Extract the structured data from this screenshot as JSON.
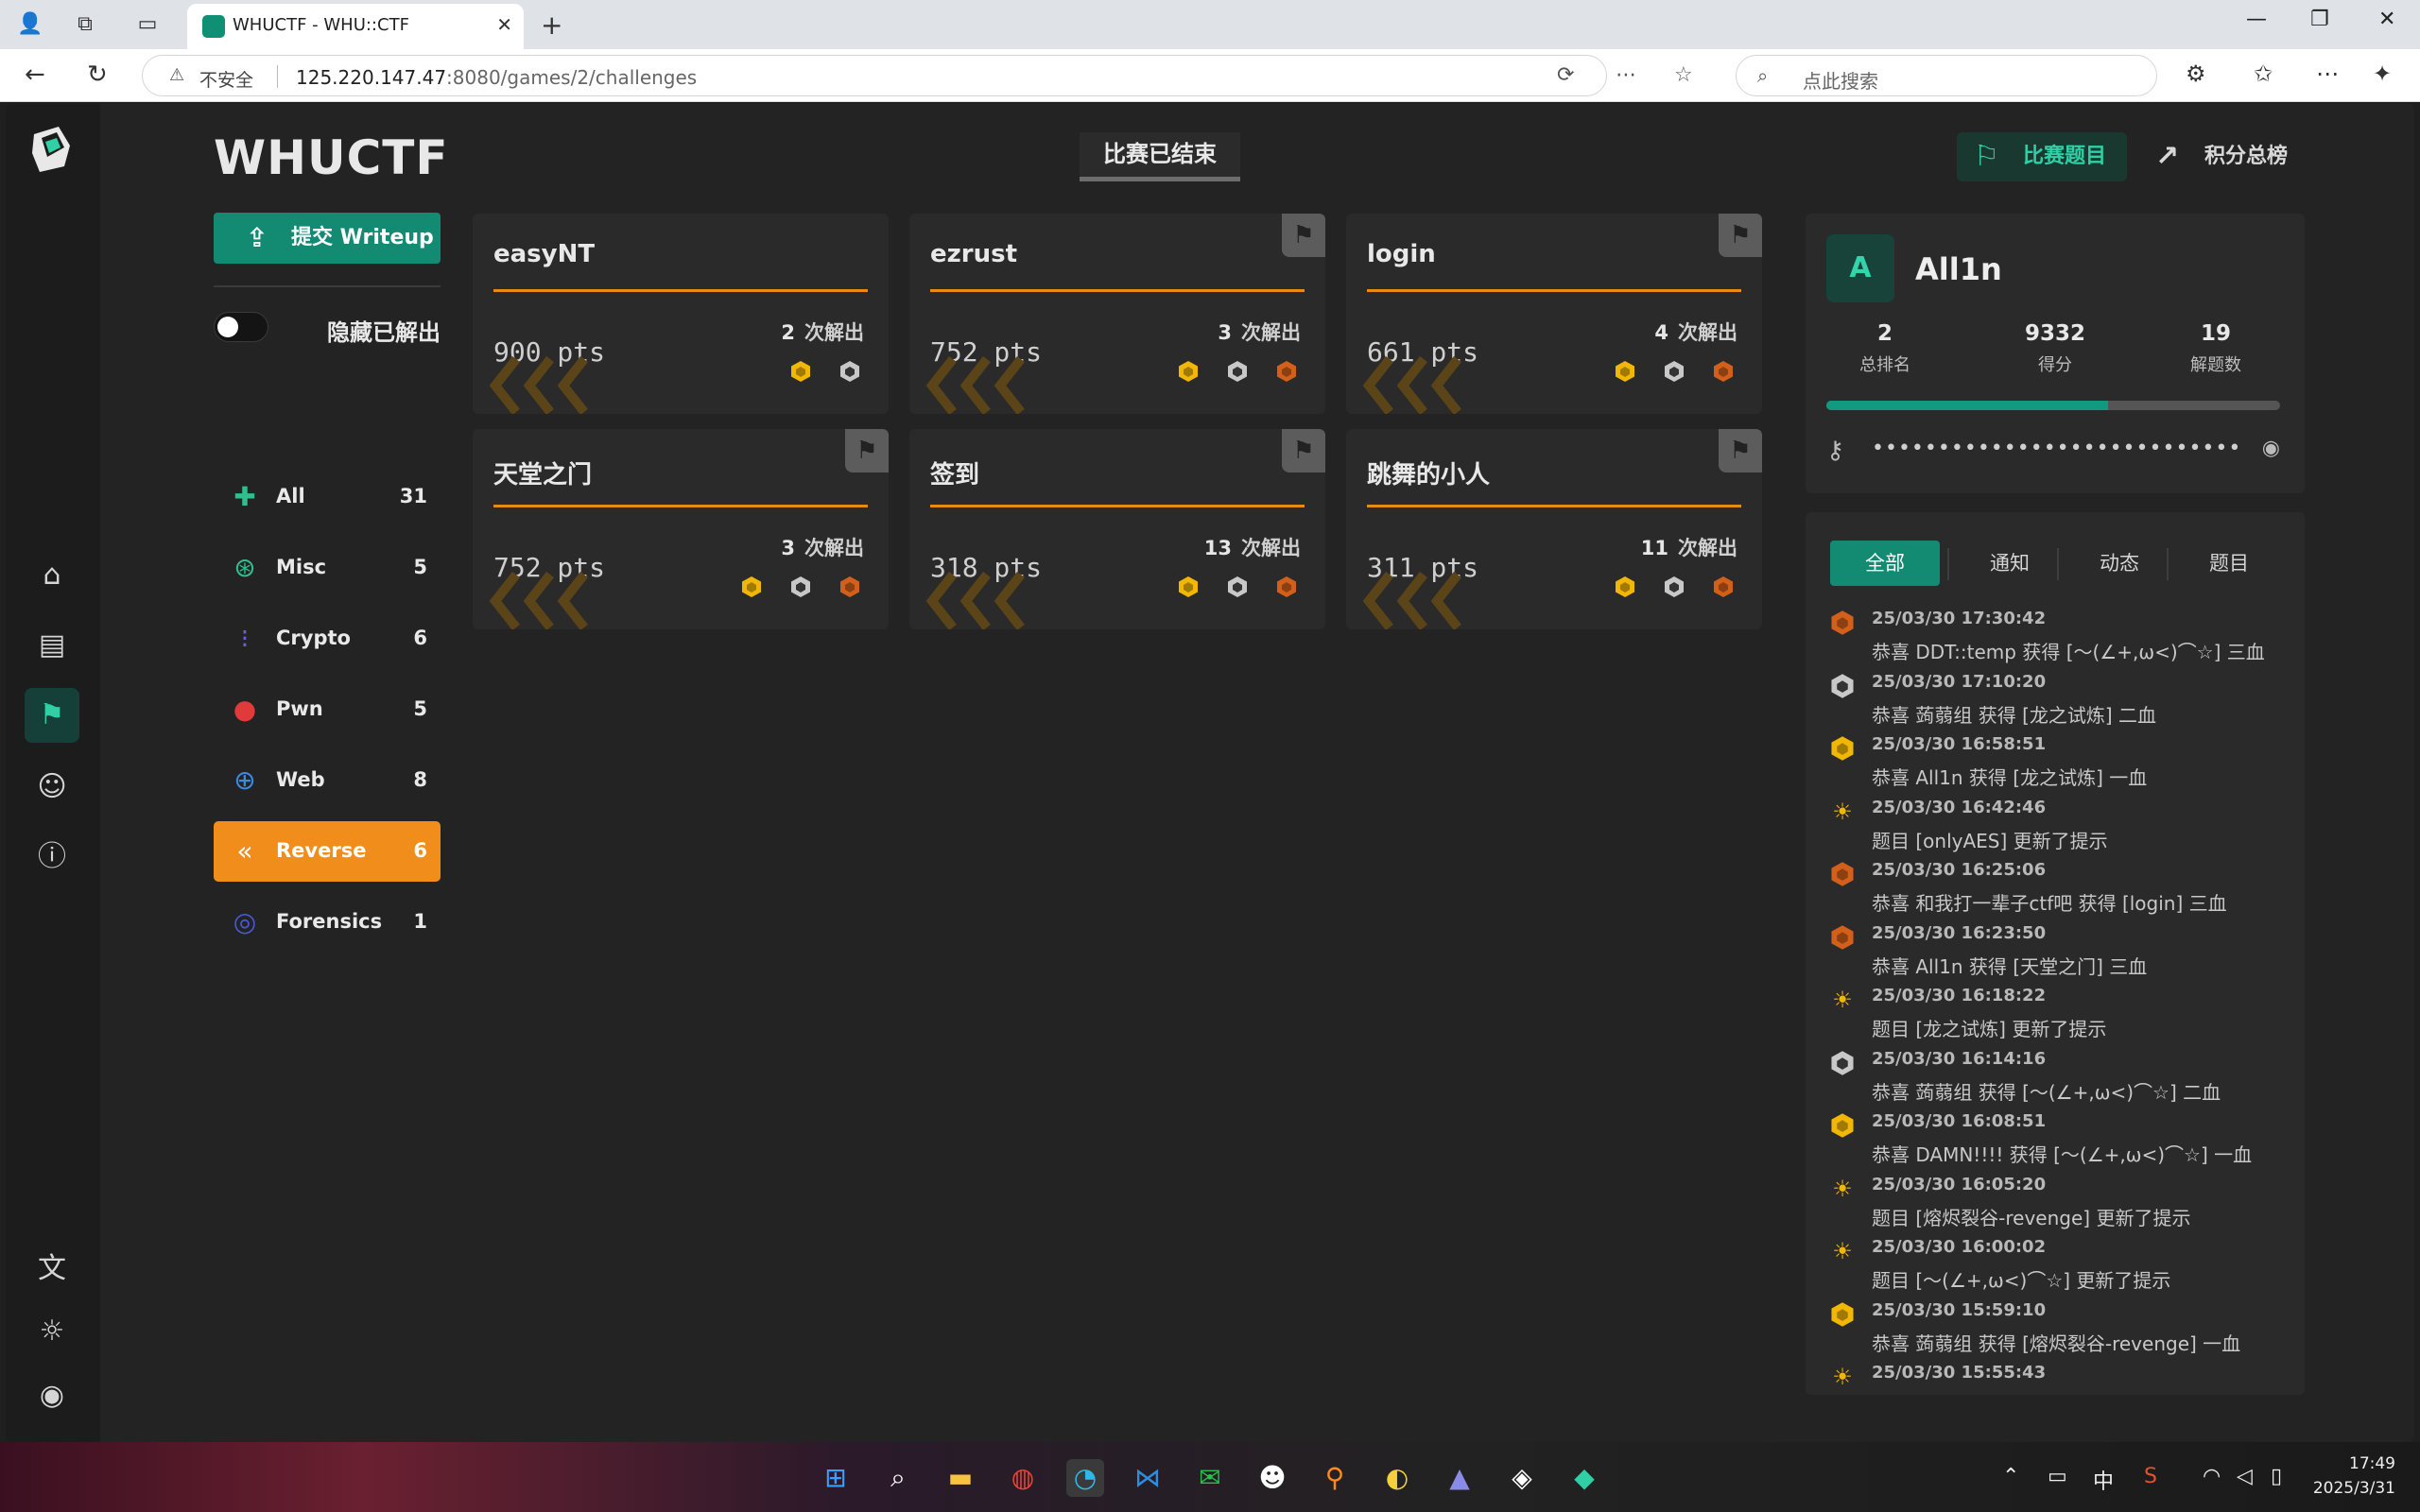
{
  "browser": {
    "tab_title": "WHUCTF - WHU::CTF",
    "insecure_label": "不安全",
    "url_host": "125.220.147.47",
    "url_rest": ":8080/games/2/challenges",
    "search_placeholder": "点此搜索"
  },
  "header": {
    "brand": "WHUCTF",
    "status": "比赛已结束",
    "nav_challenges": "比赛题目",
    "nav_scoreboard": "积分总榜"
  },
  "sidebar": {
    "submit_label": "提交 Writeup",
    "hide_solved_label": "隐藏已解出",
    "categories": [
      {
        "name": "All",
        "count": "31",
        "icon": "puzzle-icon",
        "color": "#2fbf8f"
      },
      {
        "name": "Misc",
        "count": "5",
        "icon": "gamepad-icon",
        "color": "#2fbf8f"
      },
      {
        "name": "Crypto",
        "count": "6",
        "icon": "binary-icon",
        "color": "#6b5bd6"
      },
      {
        "name": "Pwn",
        "count": "5",
        "icon": "bomb-icon",
        "color": "#e03a3a"
      },
      {
        "name": "Web",
        "count": "8",
        "icon": "globe-icon",
        "color": "#3a8ae0"
      },
      {
        "name": "Reverse",
        "count": "6",
        "icon": "chevrons-left-icon",
        "color": "#ffffff"
      },
      {
        "name": "Forensics",
        "count": "1",
        "icon": "fingerprint-icon",
        "color": "#4a5ad6"
      }
    ],
    "active_category": "Reverse"
  },
  "challenges": [
    {
      "title": "easyNT",
      "points": "900 pts",
      "solved_count": "2",
      "solved_label": "次解出",
      "bloods": [
        "gold",
        "silver"
      ],
      "has_flag": false
    },
    {
      "title": "ezrust",
      "points": "752 pts",
      "solved_count": "3",
      "solved_label": "次解出",
      "bloods": [
        "gold",
        "silver",
        "bronze"
      ],
      "has_flag": true
    },
    {
      "title": "login",
      "points": "661 pts",
      "solved_count": "4",
      "solved_label": "次解出",
      "bloods": [
        "gold",
        "silver",
        "bronze"
      ],
      "has_flag": true
    },
    {
      "title": "天堂之门",
      "points": "752 pts",
      "solved_count": "3",
      "solved_label": "次解出",
      "bloods": [
        "gold",
        "silver",
        "bronze"
      ],
      "has_flag": true
    },
    {
      "title": "签到",
      "points": "318 pts",
      "solved_count": "13",
      "solved_label": "次解出",
      "bloods": [
        "gold",
        "silver",
        "bronze"
      ],
      "has_flag": true
    },
    {
      "title": "跳舞的小人",
      "points": "311 pts",
      "solved_count": "11",
      "solved_label": "次解出",
      "bloods": [
        "gold",
        "silver",
        "bronze"
      ],
      "has_flag": true
    }
  ],
  "profile": {
    "avatar_letter": "A",
    "username": "All1n",
    "rank_value": "2",
    "rank_label": "总排名",
    "score_value": "9332",
    "score_label": "得分",
    "solves_value": "19",
    "solves_label": "解题数",
    "progress": 0.62,
    "token_mask": "••••••••••••••••••••••••••••"
  },
  "feed": {
    "tabs": [
      "全部",
      "通知",
      "动态",
      "题目"
    ],
    "items": [
      {
        "type": "bronze",
        "time": "25/03/30 17:30:42",
        "text": "恭喜 DDT::temp 获得 [～(∠+,ω<)⌒☆] 三血"
      },
      {
        "type": "silver",
        "time": "25/03/30 17:10:20",
        "text": "恭喜 蒟蒻组 获得 [龙之试炼] 二血"
      },
      {
        "type": "gold",
        "time": "25/03/30 16:58:51",
        "text": "恭喜 All1n 获得 [龙之试炼] 一血"
      },
      {
        "type": "hint",
        "time": "25/03/30 16:42:46",
        "text": "题目 [onlyAES] 更新了提示"
      },
      {
        "type": "bronze",
        "time": "25/03/30 16:25:06",
        "text": "恭喜 和我打一辈子ctf吧 获得 [login] 三血"
      },
      {
        "type": "bronze",
        "time": "25/03/30 16:23:50",
        "text": "恭喜 All1n 获得 [天堂之门] 三血"
      },
      {
        "type": "hint",
        "time": "25/03/30 16:18:22",
        "text": "题目 [龙之试炼] 更新了提示"
      },
      {
        "type": "silver",
        "time": "25/03/30 16:14:16",
        "text": "恭喜 蒟蒻组 获得 [～(∠+,ω<)⌒☆] 二血"
      },
      {
        "type": "gold",
        "time": "25/03/30 16:08:51",
        "text": "恭喜 DAMN!!!! 获得 [～(∠+,ω<)⌒☆] 一血"
      },
      {
        "type": "hint",
        "time": "25/03/30 16:05:20",
        "text": "题目 [熔烬裂谷-revenge] 更新了提示"
      },
      {
        "type": "hint",
        "time": "25/03/30 16:00:02",
        "text": "题目 [～(∠+,ω<)⌒☆] 更新了提示"
      },
      {
        "type": "gold",
        "time": "25/03/30 15:59:10",
        "text": "恭喜 蒟蒻组 获得 [熔烬裂谷-revenge] 一血"
      },
      {
        "type": "hint",
        "time": "25/03/30 15:55:43",
        "text": ""
      }
    ]
  },
  "taskbar": {
    "ime": "中",
    "time": "17:49",
    "date": "2025/3/31"
  },
  "colors": {
    "accent": "#138a72",
    "orange": "#f18d1a",
    "gold": "#f2b705",
    "silver": "#c8c8c8",
    "bronze": "#d2601a"
  }
}
